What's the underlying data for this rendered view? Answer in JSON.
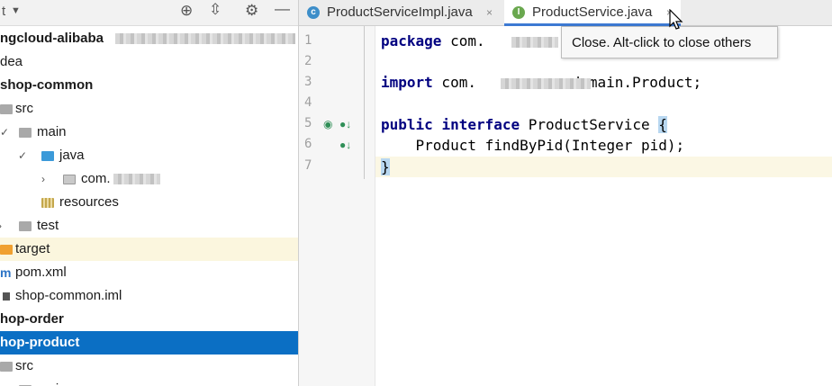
{
  "left_toolbar": {
    "view_label": "t",
    "icons": [
      "dropdown-icon",
      "target-icon",
      "collapse-all-icon",
      "gear-icon",
      "minimize-icon"
    ]
  },
  "project_tree": [
    {
      "label": "ngcloud-alibaba",
      "bold": true,
      "kind": "root"
    },
    {
      "label": "dea",
      "kind": "folder"
    },
    {
      "label": "shop-common",
      "bold": true,
      "kind": "module"
    },
    {
      "label": "src",
      "kind": "folder"
    },
    {
      "label": "main",
      "kind": "folder"
    },
    {
      "label": "java",
      "kind": "folder"
    },
    {
      "label": "com.",
      "kind": "package"
    },
    {
      "label": "resources",
      "kind": "folder"
    },
    {
      "label": "test",
      "kind": "folder"
    },
    {
      "label": "target",
      "kind": "folder"
    },
    {
      "label": "pom.xml",
      "kind": "file"
    },
    {
      "label": "shop-common.iml",
      "kind": "file"
    },
    {
      "label": "hop-order",
      "bold": true,
      "kind": "module"
    },
    {
      "label": "hop-product",
      "bold": true,
      "kind": "module",
      "selected": true
    },
    {
      "label": "src",
      "kind": "folder"
    },
    {
      "label": "main",
      "kind": "folder"
    }
  ],
  "editor": {
    "tabs": [
      {
        "label": "ProductServiceImpl.java",
        "icon": "class-icon",
        "icon_letter": "c",
        "active": false
      },
      {
        "label": "ProductService.java",
        "icon": "interface-icon",
        "icon_letter": "I",
        "active": true
      }
    ],
    "close_glyph": "×",
    "tooltip": "Close. Alt-click to close others",
    "line_numbers": [
      "1",
      "2",
      "3",
      "4",
      "5",
      "6",
      "7"
    ],
    "code": {
      "line1_kw": "package",
      "line1_rest": " com.",
      "line3_kw": "import",
      "line3_a": " com.",
      "line3_b": ".domain.Product;",
      "line5_kw1": "public",
      "line5_kw2": "interface",
      "line5_name": " ProductService ",
      "line5_brace": "{",
      "line6": "    Product findByPid(Integer pid);",
      "line7_brace": "}"
    }
  },
  "colors": {
    "selection": "#0b6fc4",
    "keyword": "#000080",
    "tab_underline": "#3d7ad3",
    "target_row": "#fbf6de",
    "current_line": "#fbf7e4"
  }
}
